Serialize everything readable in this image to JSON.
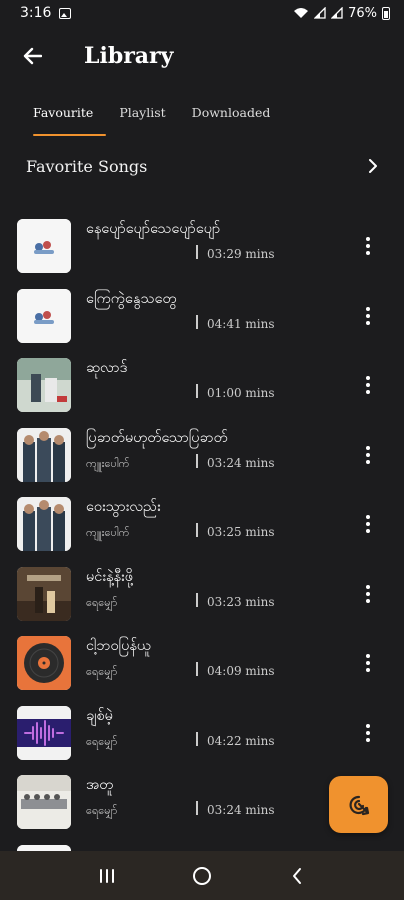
{
  "status": {
    "time": "3:16",
    "battery": "76%"
  },
  "header": {
    "title": "Library"
  },
  "tabs": [
    {
      "label": "Favourite",
      "active": true
    },
    {
      "label": "Playlist",
      "active": false
    },
    {
      "label": "Downloaded",
      "active": false
    }
  ],
  "section": {
    "title": "Favorite Songs"
  },
  "songs": [
    {
      "title": "နေပျော်ပျော်သေပျော်ပျော်",
      "artist": "",
      "duration": "03:29 mins",
      "thumb": "white"
    },
    {
      "title": "ကြေကွဲနွေသတွေ",
      "artist": "",
      "duration": "04:41 mins",
      "thumb": "white"
    },
    {
      "title": "ဆုလာဒ်",
      "artist": "",
      "duration": "01:00 mins",
      "thumb": "photo"
    },
    {
      "title": "ပြခာတ်မဟုတ်သောပြခာတ်",
      "artist": "ကျူးပေါက်",
      "duration": "03:24 mins",
      "thumb": "band"
    },
    {
      "title": "ဝေးသွားလည်း",
      "artist": "ကျူးပေါက်",
      "duration": "03:25 mins",
      "thumb": "band"
    },
    {
      "title": "မင်းနဲ့နီးဖို့",
      "artist": "ရေမျှော်",
      "duration": "03:23 mins",
      "thumb": "dark"
    },
    {
      "title": "ငါ့ဘဝပြန်ယူ",
      "artist": "ရေမျှော်",
      "duration": "04:09 mins",
      "thumb": "vinyl"
    },
    {
      "title": "ချစ်မဲ့",
      "artist": "ရေမျှော်",
      "duration": "04:22 mins",
      "thumb": "wave"
    },
    {
      "title": "အတူ",
      "artist": "ရေမျှော်",
      "duration": "03:24 mins",
      "thumb": "stage"
    },
    {
      "title": "",
      "artist": "",
      "duration": "",
      "thumb": "white"
    }
  ],
  "colors": {
    "accent": "#f0922e",
    "background": "#1c1c1e",
    "navbar": "#2b2723"
  }
}
